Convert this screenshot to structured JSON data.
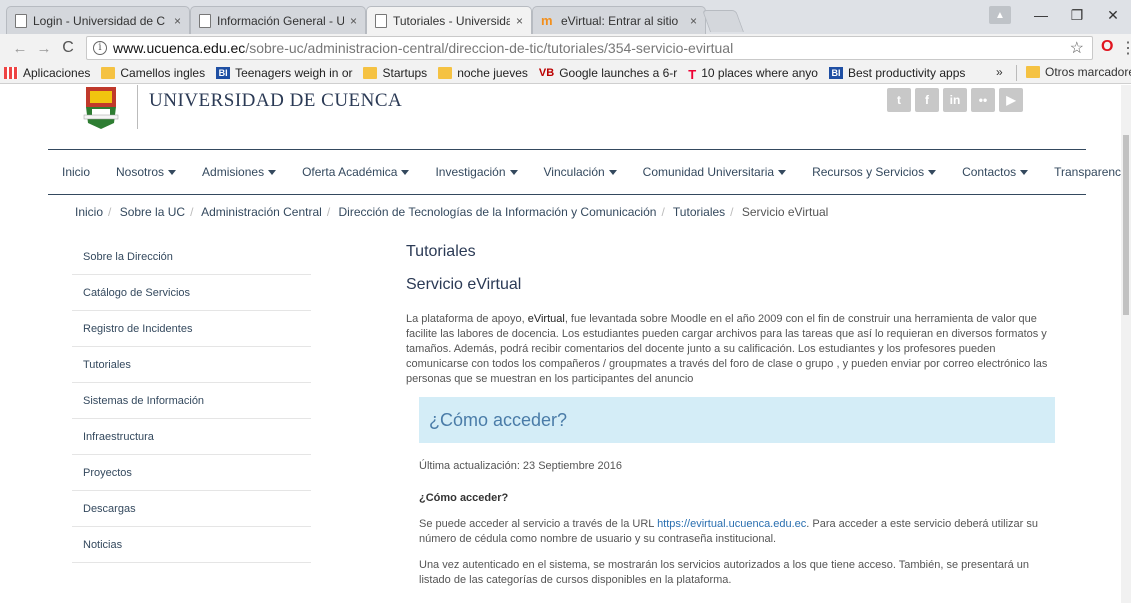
{
  "browser": {
    "tabs": [
      {
        "title": "Login - Universidad de C",
        "icon": "page-icon",
        "active": false
      },
      {
        "title": "Información General - Ur",
        "icon": "page-icon",
        "active": false
      },
      {
        "title": "Tutoriales - Universidad",
        "icon": "page-icon",
        "active": true
      },
      {
        "title": "eVirtual: Entrar al sitio",
        "icon": "moodle-icon",
        "active": false
      }
    ],
    "tab_close": "×",
    "url_host": "www.ucuenca.edu.ec",
    "url_path": "/sobre-uc/administracion-central/direccion-de-tic/tutoriales/354-servicio-evirtual",
    "bookmarks": [
      {
        "label": "Aplicaciones",
        "icon": "apps-icon"
      },
      {
        "label": "Camellos ingles",
        "icon": "folder-icon"
      },
      {
        "label": "Teenagers weigh in or",
        "icon": "bi-icon"
      },
      {
        "label": "Startups",
        "icon": "folder-icon"
      },
      {
        "label": "noche jueves",
        "icon": "folder-icon"
      },
      {
        "label": "Google launches a 6-r",
        "icon": "vb-icon"
      },
      {
        "label": "10 places where anyo",
        "icon": "t-icon"
      },
      {
        "label": "Best productivity apps",
        "icon": "bi-icon"
      }
    ],
    "bookmarks_more": "»",
    "other_bookmarks": "Otros marcadores"
  },
  "site": {
    "name": "UNIVERSIDAD DE CUENCA",
    "social": [
      "twitter-icon",
      "facebook-icon",
      "linkedin-icon",
      "flickr-icon",
      "youtube-icon"
    ],
    "social_glyphs": [
      "t",
      "f",
      "in",
      "••",
      "▶"
    ],
    "nav": [
      {
        "label": "Inicio",
        "dropdown": false
      },
      {
        "label": "Nosotros",
        "dropdown": true
      },
      {
        "label": "Admisiones",
        "dropdown": true
      },
      {
        "label": "Oferta Académica",
        "dropdown": true
      },
      {
        "label": "Investigación",
        "dropdown": true
      },
      {
        "label": "Vinculación",
        "dropdown": true
      },
      {
        "label": "Comunidad Universitaria",
        "dropdown": true
      },
      {
        "label": "Recursos y Servicios",
        "dropdown": true
      },
      {
        "label": "Contactos",
        "dropdown": true
      },
      {
        "label": "Transparencia",
        "dropdown": false
      }
    ],
    "breadcrumb": [
      "Inicio",
      "Sobre la UC",
      "Administración Central",
      "Dirección de Tecnologías de la Información y Comunicación",
      "Tutoriales",
      "Servicio eVirtual"
    ],
    "sidebar": [
      "Sobre la Dirección",
      "Catálogo de Servicios",
      "Registro de Incidentes",
      "Tutoriales",
      "Sistemas de Información",
      "Infraestructura",
      "Proyectos",
      "Descargas",
      "Noticias"
    ]
  },
  "content": {
    "title": "Tutoriales",
    "subtitle": "Servicio eVirtual",
    "intro_before": "La plataforma de apoyo, ",
    "intro_highlight": "eVirtual",
    "intro_after": ", fue levantada sobre Moodle en el año 2009 con el fin de construir una herramienta de valor que facilite las labores de docencia. Los estudiantes pueden cargar archivos para las tareas que así lo requieran en diversos formatos y tamaños. Además, podrá recibir comentarios del docente junto a su calificación. Los estudiantes y los profesores pueden comunicarse con todos los compañeros / groupmates a través del foro de clase o grupo , y pueden enviar por correo electrónico las personas que se muestran en los participantes del anuncio",
    "accordion_title": "¿Cómo acceder?",
    "updated": "Última actualización: 23 Septiembre 2016",
    "question": "¿Cómo acceder?",
    "para1_before": "Se puede acceder al servicio a través de la URL ",
    "para1_link": "https://evirtual.ucuenca.edu.ec",
    "para1_after": ". Para acceder a este servicio deberá utilizar su número de cédula como nombre de usuario y su contraseña institucional.",
    "para2": "Una vez autenticado en el sistema, se mostrarán los servicios autorizados a los que tiene acceso. También, se presentará un listado de las categorías de cursos disponibles en la plataforma."
  }
}
